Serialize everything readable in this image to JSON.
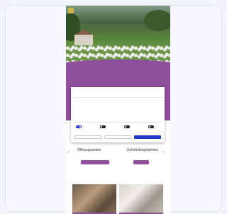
{
  "colors": {
    "brand_purple": "#8e4f9d",
    "accept_blue": "#1f3cc8",
    "page_bg": "#f3f5f9"
  },
  "icons": {
    "logo": "site-logo",
    "prev": "chevron-left-icon",
    "next": "chevron-right-icon"
  },
  "categories": [
    {
      "title": "Öffnungszeiten"
    },
    {
      "title": "Zahnfüllungsfahrten"
    }
  ],
  "cookie_dialog": {
    "toggles": [
      {
        "state": "on"
      },
      {
        "state": "off"
      },
      {
        "state": "off"
      },
      {
        "state": "off"
      }
    ]
  }
}
